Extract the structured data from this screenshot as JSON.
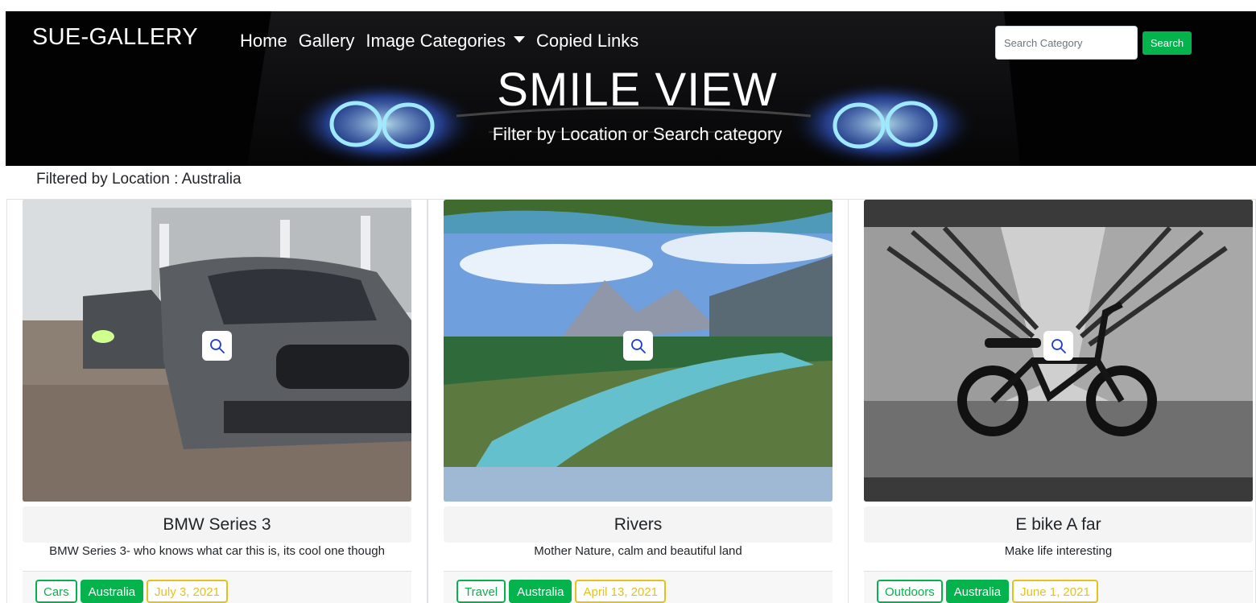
{
  "navbar": {
    "brand": "SUE-GALLERY",
    "links": [
      "Home",
      "Gallery",
      "Image Categories",
      "Copied Links"
    ],
    "search_placeholder": "Search Category",
    "search_button": "Search"
  },
  "hero": {
    "title": "SMILE VIEW",
    "subtitle": "Filter by Location or Search category"
  },
  "filter": {
    "label": "Filtered by Location : Australia"
  },
  "cards": [
    {
      "title": "BMW Series 3",
      "description": "BMW Series 3- who knows what car this is, its cool one though",
      "category": "Cars",
      "location": "Australia",
      "date": "July 3, 2021"
    },
    {
      "title": "Rivers",
      "description": "Mother Nature, calm and beautiful land",
      "category": "Travel",
      "location": "Australia",
      "date": "April 13, 2021"
    },
    {
      "title": "E bike A far",
      "description": "Make life interesting",
      "category": "Outdoors",
      "location": "Australia",
      "date": "June 1, 2021"
    }
  ],
  "colors": {
    "accent_green": "#05b34d",
    "date_yellow": "#e4c21a",
    "hero_bg": "#020203"
  }
}
